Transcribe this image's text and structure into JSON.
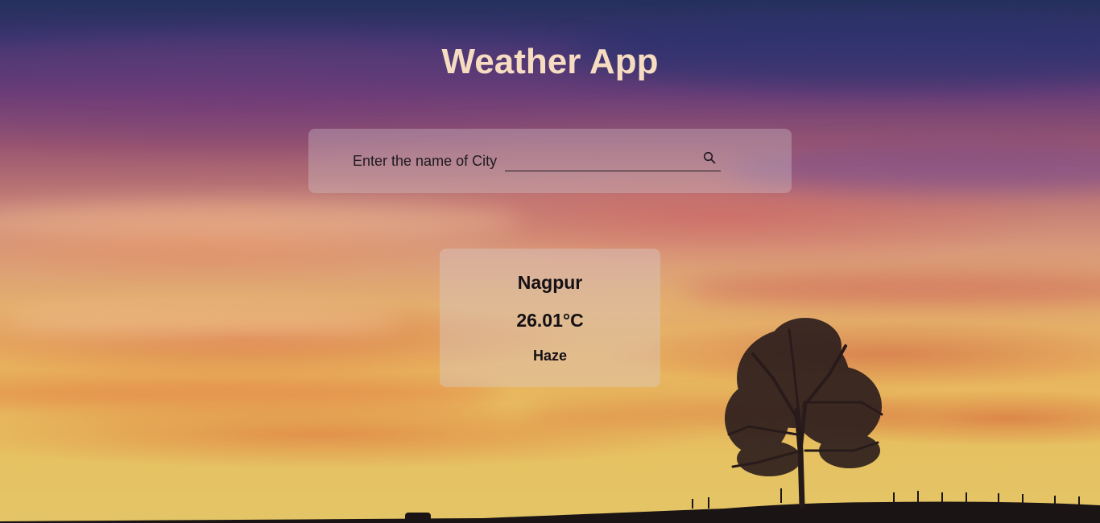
{
  "app": {
    "title": "Weather App"
  },
  "search": {
    "label": "Enter the name of City",
    "value": "",
    "placeholder": "",
    "icon": "search-icon"
  },
  "weather": {
    "city": "Nagpur",
    "temperature": "26.01°C",
    "condition": "Haze"
  },
  "colors": {
    "title": "#f6dcc0",
    "text": "#141014",
    "panel": "rgba(210,200,205,0.35)"
  }
}
